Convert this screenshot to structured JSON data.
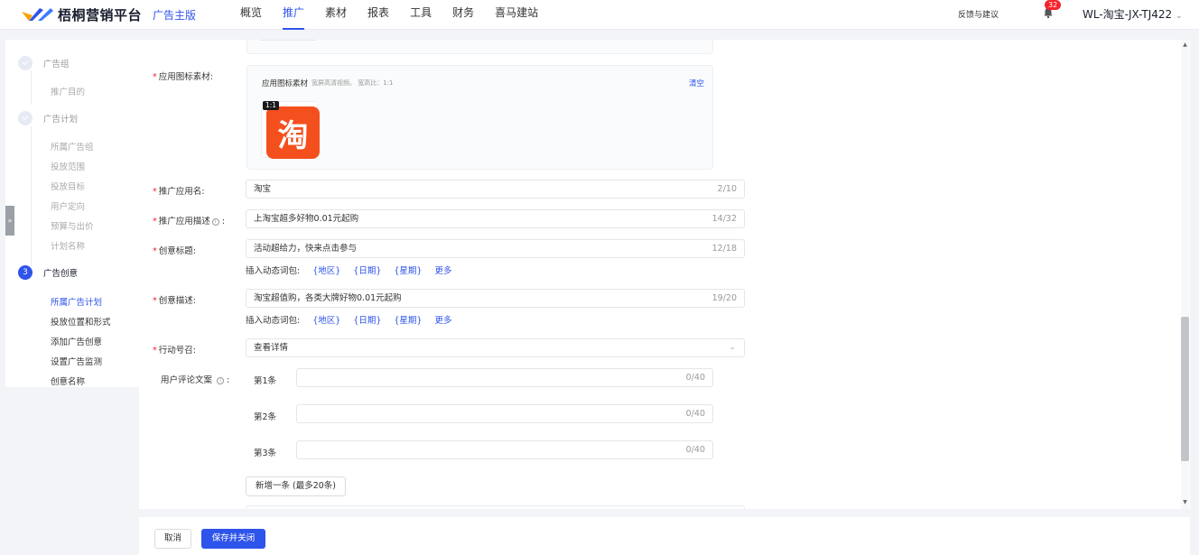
{
  "header": {
    "brand": "梧桐营销平台",
    "subtitle": "广告主版",
    "nav": [
      "概览",
      "推广",
      "素材",
      "报表",
      "工具",
      "财务",
      "喜马建站"
    ],
    "active_nav": "推广",
    "feedback": "反馈与建议",
    "notifications": "32",
    "account": "WL-淘宝-JX-TJ422",
    "chevron": "⌄"
  },
  "sidebar": {
    "expand": "»",
    "steps": [
      {
        "num": "",
        "label": "广告组",
        "subs": [
          "推广目的"
        ]
      },
      {
        "num": "",
        "label": "广告计划",
        "subs": [
          "所属广告组",
          "投放范围",
          "投放目标",
          "用户定向",
          "预算与出价",
          "计划名称"
        ]
      },
      {
        "num": "3",
        "label": "广告创意",
        "subs": [
          "所属广告计划",
          "投放位置和形式",
          "添加广告创意",
          "设置广告监测",
          "创意名称"
        ]
      }
    ]
  },
  "form": {
    "icon_label": "应用图标素材:",
    "icon_card_title": "应用图标素材",
    "icon_hint": "宽屏高清视频。 宽高比：1:1",
    "icon_clear": "清空",
    "icon_ratio": "1:1",
    "icon_glyph": "淘",
    "app_name_label": "推广应用名:",
    "app_name_value": "淘宝",
    "app_name_count": "2/10",
    "app_desc_label": "推广应用描述",
    "app_desc_value": "上淘宝超多好物0.01元起购",
    "app_desc_count": "14/32",
    "title_label": "创意标题:",
    "title_value": "活动超给力，快来点击参与",
    "title_count": "12/18",
    "dyn_label": "插入动态词包:",
    "dyn_tags": [
      "{地区}",
      "{日期}",
      "{星期}",
      "更多"
    ],
    "desc_label": "创意描述:",
    "desc_value": "淘宝超值购，各类大牌好物0.01元起购",
    "desc_count": "19/20",
    "cta_label": "行动号召:",
    "cta_value": "查看详情",
    "comment_label": "用户评论文案",
    "comments": [
      {
        "label": "第1条",
        "count": "0/40"
      },
      {
        "label": "第2条",
        "count": "0/40"
      },
      {
        "label": "第3条",
        "count": "0/40"
      }
    ],
    "add_comment": "新增一条 (最多20条)"
  },
  "footer": {
    "cancel": "取消",
    "save": "保存并关闭"
  },
  "colors": {
    "accent": "#2f54eb",
    "required": "#f5222d",
    "taobao": "#f4501e"
  }
}
